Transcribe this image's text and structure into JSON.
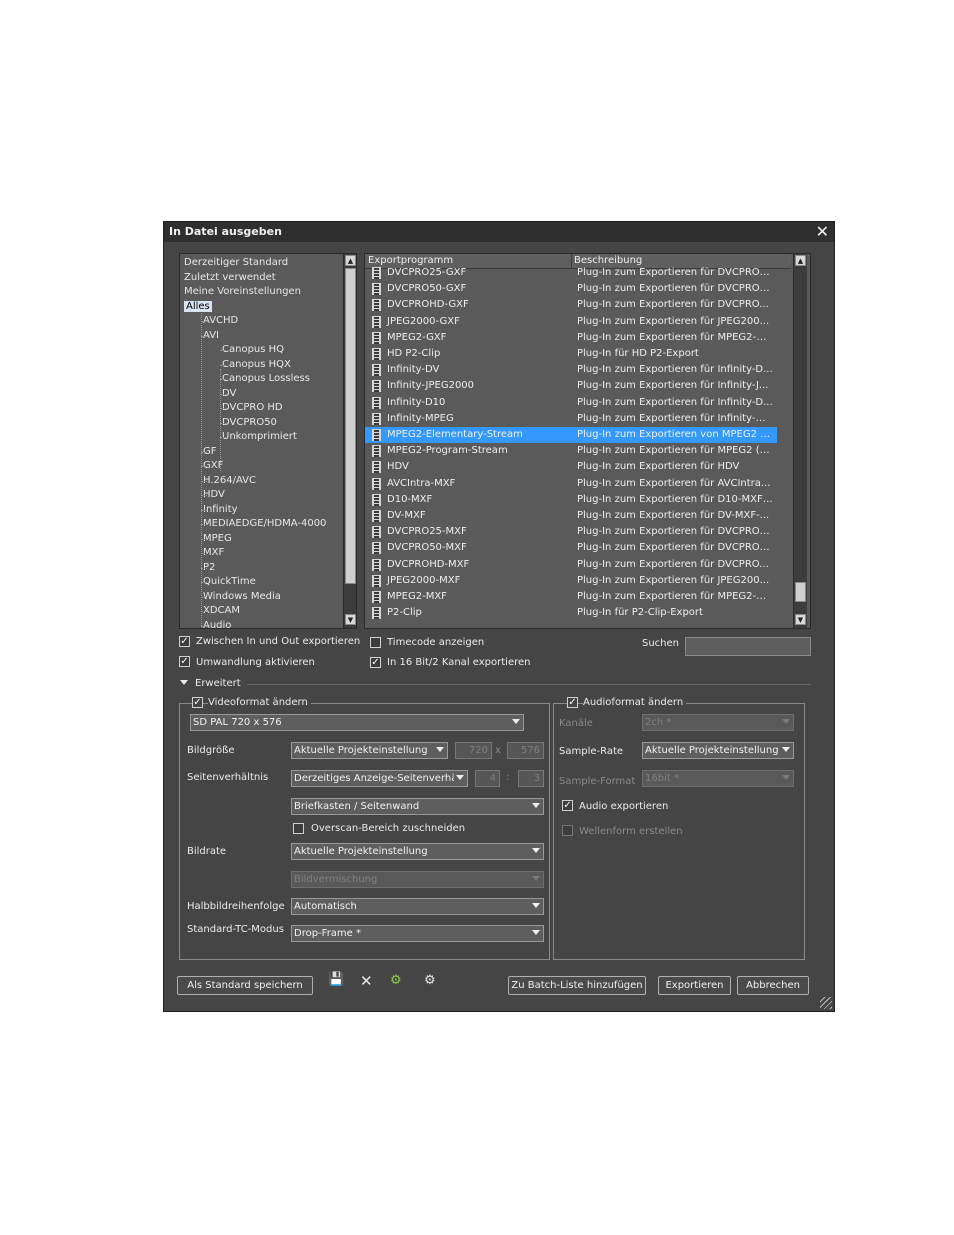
{
  "window": {
    "title": "In Datei ausgeben",
    "close_glyph": "✕"
  },
  "tree": {
    "items": [
      {
        "label": "Derzeitiger Standard",
        "level": 0
      },
      {
        "label": "Zuletzt verwendet",
        "level": 0
      },
      {
        "label": "Meine Voreinstellungen",
        "level": 0
      },
      {
        "label": "Alles",
        "level": 0,
        "selected": true
      },
      {
        "label": "AVCHD",
        "level": 1
      },
      {
        "label": "AVI",
        "level": 1
      },
      {
        "label": "Canopus HQ",
        "level": 2
      },
      {
        "label": "Canopus HQX",
        "level": 2
      },
      {
        "label": "Canopus Lossless",
        "level": 2
      },
      {
        "label": "DV",
        "level": 2
      },
      {
        "label": "DVCPRO HD",
        "level": 2
      },
      {
        "label": "DVCPRO50",
        "level": 2
      },
      {
        "label": "Unkomprimiert",
        "level": 2
      },
      {
        "label": "GF",
        "level": 1
      },
      {
        "label": "GXF",
        "level": 1
      },
      {
        "label": "H.264/AVC",
        "level": 1
      },
      {
        "label": "HDV",
        "level": 1
      },
      {
        "label": "Infinity",
        "level": 1
      },
      {
        "label": "MEDIAEDGE/HDMA-4000",
        "level": 1
      },
      {
        "label": "MPEG",
        "level": 1
      },
      {
        "label": "MXF",
        "level": 1
      },
      {
        "label": "P2",
        "level": 1
      },
      {
        "label": "QuickTime",
        "level": 1
      },
      {
        "label": "Windows Media",
        "level": 1
      },
      {
        "label": "XDCAM",
        "level": 1
      },
      {
        "label": "Audio",
        "level": 1
      }
    ]
  },
  "exporters": {
    "col_program": "Exportprogramm",
    "col_desc": "Beschreibung",
    "rows": [
      {
        "name": "DVCPRO25-GXF",
        "desc": "Plug-In zum Exportieren für DVCPRO2..."
      },
      {
        "name": "DVCPRO50-GXF",
        "desc": "Plug-In zum Exportieren für DVCPRO5..."
      },
      {
        "name": "DVCPROHD-GXF",
        "desc": "Plug-In zum Exportieren für DVCPRO..."
      },
      {
        "name": "JPEG2000-GXF",
        "desc": "Plug-In zum Exportieren für JPEG200..."
      },
      {
        "name": "MPEG2-GXF",
        "desc": "Plug-In zum Exportieren für MPEG2-G..."
      },
      {
        "name": "HD P2-Clip",
        "desc": "Plug-In für HD P2-Export"
      },
      {
        "name": "Infinity-DV",
        "desc": "Plug-In zum Exportieren für Infinity-D..."
      },
      {
        "name": "Infinity-JPEG2000",
        "desc": "Plug-In zum Exportieren für Infinity-J..."
      },
      {
        "name": "Infinity-D10",
        "desc": "Plug-In zum Exportieren für Infinity-D..."
      },
      {
        "name": "Infinity-MPEG",
        "desc": "Plug-In zum Exportieren für Infinity-M..."
      },
      {
        "name": "MPEG2-Elementary-Stream",
        "desc": "Plug-In zum Exportieren von MPEG2 (...",
        "selected": true
      },
      {
        "name": "MPEG2-Program-Stream",
        "desc": "Plug-In zum Exportieren für MPEG2 (P..."
      },
      {
        "name": "HDV",
        "desc": "Plug-In zum Exportieren für HDV"
      },
      {
        "name": "AVCIntra-MXF",
        "desc": "Plug-In zum Exportieren für AVCIntra..."
      },
      {
        "name": "D10-MXF",
        "desc": "Plug-In zum Exportieren für D10-MXF-..."
      },
      {
        "name": "DV-MXF",
        "desc": "Plug-In zum Exportieren für DV-MXF-..."
      },
      {
        "name": "DVCPRO25-MXF",
        "desc": "Plug-In zum Exportieren für DVCPRO2..."
      },
      {
        "name": "DVCPRO50-MXF",
        "desc": "Plug-In zum Exportieren für DVCPRO5..."
      },
      {
        "name": "DVCPROHD-MXF",
        "desc": "Plug-In zum Exportieren für DVCPRO..."
      },
      {
        "name": "JPEG2000-MXF",
        "desc": "Plug-In zum Exportieren für JPEG200..."
      },
      {
        "name": "MPEG2-MXF",
        "desc": "Plug-In zum Exportieren für MPEG2-M..."
      },
      {
        "name": "P2-Clip",
        "desc": "Plug-In für P2-Clip-Export"
      }
    ]
  },
  "options": {
    "between_in_out": "Zwischen In und Out exportieren",
    "conversion": "Umwandlung aktivieren",
    "show_timecode": "Timecode anzeigen",
    "export_16bit": "In 16 Bit/2 Kanal exportieren",
    "search_label": "Suchen",
    "search_value": ""
  },
  "advanced": {
    "label": "Erweitert",
    "video": {
      "group_label": "Videoformat ändern",
      "preset": "SD PAL 720 x 576",
      "size_label": "Bildgröße",
      "size_value": "Aktuelle Projekteinstellung",
      "width": "720",
      "height": "576",
      "x_sep": "x",
      "aspect_label": "Seitenverhältnis",
      "aspect_value": "Derzeitiges Anzeige-Seitenverhält",
      "aspect_w": "4",
      "aspect_h": "3",
      "colon": ":",
      "letterbox_value": "Briefkasten / Seitenwand",
      "overscan_label": "Overscan-Bereich zuschneiden",
      "framerate_label": "Bildrate",
      "framerate_value": "Aktuelle Projekteinstellung",
      "blend_value": "Bildvermischung",
      "field_order_label": "Halbbildreihenfolge",
      "field_order_value": "Automatisch",
      "tc_label": "Standard-TC-Modus",
      "tc_value": "Drop-Frame *"
    },
    "audio": {
      "group_label": "Audioformat ändern",
      "channels_label": "Kanäle",
      "channels_value": "2ch *",
      "rate_label": "Sample-Rate",
      "rate_value": "Aktuelle Projekteinstellung",
      "format_label": "Sample-Format",
      "format_value": "16bit *",
      "export_audio": "Audio exportieren",
      "waveform": "Wellenform erstellen"
    }
  },
  "buttons": {
    "save_default": "Als Standard speichern",
    "add_batch": "Zu Batch-Liste hinzufügen",
    "export": "Exportieren",
    "cancel": "Abbrechen"
  },
  "icons": [
    "save-icon",
    "delete-icon",
    "import-preset-icon",
    "export-preset-icon"
  ]
}
